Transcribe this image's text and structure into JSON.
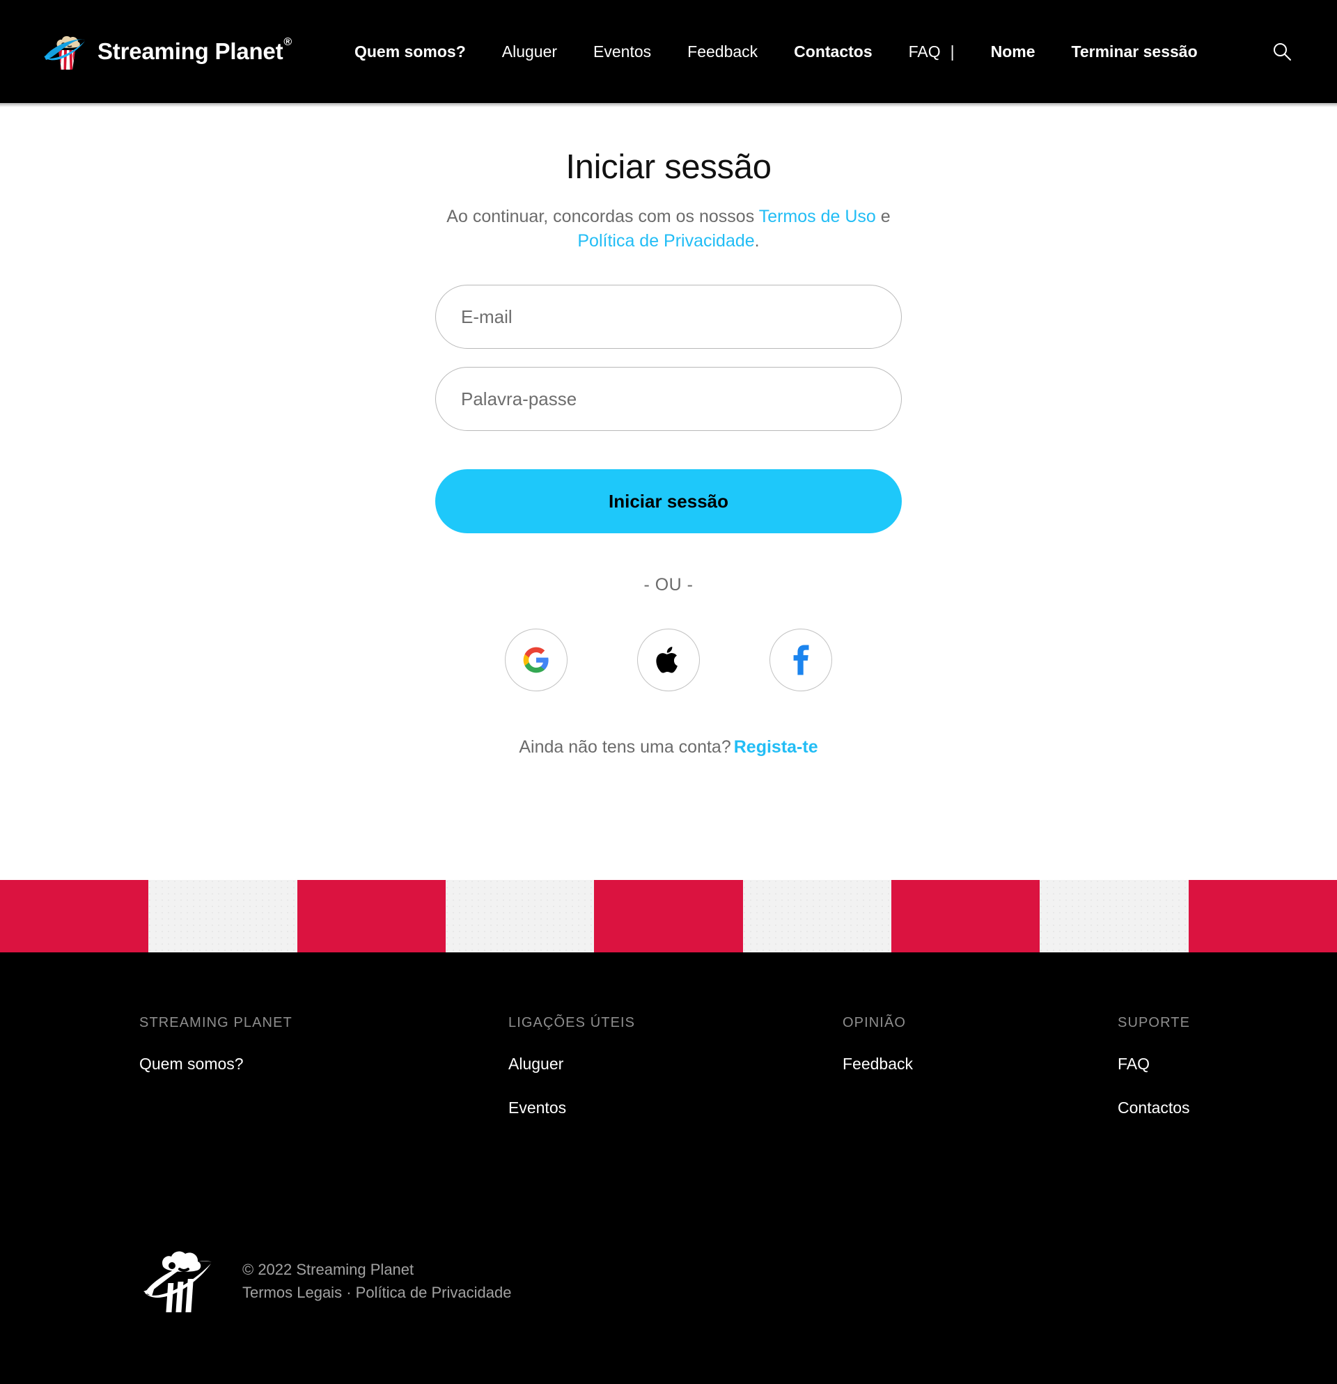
{
  "header": {
    "brand": {
      "name": "Streaming Planet",
      "trademark": "®",
      "logo_icon": "streaming-planet-popcorn-logo"
    },
    "nav": [
      {
        "label": "Quem somos?",
        "bold": true
      },
      {
        "label": "Aluguer",
        "bold": false
      },
      {
        "label": "Eventos",
        "bold": false
      },
      {
        "label": "Feedback",
        "bold": false
      },
      {
        "label": "Contactos",
        "bold": true
      },
      {
        "label": "FAQ",
        "bold": false
      }
    ],
    "separator": "|",
    "account": [
      {
        "label": "Nome",
        "bold": true
      },
      {
        "label": "Terminar sessão",
        "bold": true
      }
    ],
    "search_icon": "search-icon"
  },
  "login": {
    "title": "Iniciar sessão",
    "consent_prefix": "Ao continuar, concordas com os nossos ",
    "terms_link": "Termos de Uso",
    "consent_middle": " e ",
    "privacy_link": "Política de Privacidade",
    "consent_suffix": ".",
    "email_placeholder": "E-mail",
    "email_value": "",
    "password_placeholder": "Palavra-passe",
    "password_value": "",
    "submit_label": "Iniciar sessão",
    "or_divider": "- OU -",
    "social": [
      {
        "name": "google",
        "icon": "google-icon"
      },
      {
        "name": "apple",
        "icon": "apple-icon"
      },
      {
        "name": "facebook",
        "icon": "facebook-icon"
      }
    ],
    "signup_prompt": "Ainda não tens uma conta?",
    "signup_link": "Regista-te"
  },
  "stripes": {
    "colors": [
      "#db1340",
      "#f2f2f2"
    ],
    "count": 9
  },
  "footer": {
    "columns": [
      {
        "heading": "STREAMING PLANET",
        "links": [
          "Quem somos?"
        ]
      },
      {
        "heading": "LIGAÇÕES ÚTEIS",
        "links": [
          "Aluguer",
          "Eventos"
        ]
      },
      {
        "heading": "OPINIÃO",
        "links": [
          "Feedback"
        ]
      },
      {
        "heading": "SUPORTE",
        "links": [
          "FAQ",
          "Contactos"
        ]
      }
    ],
    "logo_icon": "streaming-planet-popcorn-logo-white",
    "copyright": "© 2022 Streaming Planet",
    "legal_terms": "Termos Legais",
    "legal_sep": " · ",
    "legal_privacy": "Política de Privacidade"
  },
  "colors": {
    "brand_black": "#000000",
    "accent_blue": "#1ec8fa",
    "link_blue": "#22bdf5",
    "stripe_red": "#db1340",
    "muted_text": "#6b6b6b"
  }
}
